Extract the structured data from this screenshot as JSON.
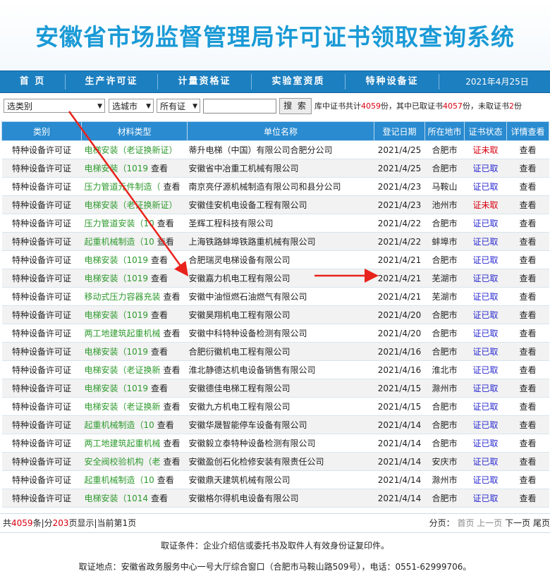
{
  "header": {
    "title": "安徽省市场监督管理局许可证书领取查询系统"
  },
  "nav": {
    "items": [
      "首 页",
      "生产许可证",
      "计量资格证",
      "实验室资质",
      "特种设备证"
    ],
    "date": "2021年4月25日"
  },
  "toolbar": {
    "category_select": "选类别",
    "city_select": "选城市",
    "cert_select": "所有证",
    "search_value": "",
    "search_button": "搜 索",
    "summary_prefix": "库中证书共计",
    "total": "4059",
    "summary_mid1": "份，其中已取证书",
    "taken": "4057",
    "summary_mid2": "份，未取证书",
    "not_taken": "2",
    "summary_end": "份"
  },
  "table": {
    "headers": [
      "类别",
      "材料类型",
      "单位名称",
      "登记日期",
      "所在地市",
      "证书状态",
      "详情查看"
    ],
    "rows": [
      {
        "type": "特种设备许可证",
        "material": "电梯安装（老证换新证）",
        "view_text": "",
        "unit": "蒂升电梯（中国）有限公司合肥分公司",
        "date": "2021/4/25",
        "city": "合肥市",
        "status": "证未取",
        "action": "查看"
      },
      {
        "type": "特种设备许可证",
        "material": "电梯安装（1019",
        "view_text": "查看",
        "unit": "安徽省中冶重工机械有限公司",
        "date": "2021/4/25",
        "city": "合肥市",
        "status": "证已取",
        "action": "查看"
      },
      {
        "type": "特种设备许可证",
        "material": "压力管道元件制造（",
        "view_text": "查看",
        "unit": "南京亮仔源机械制造有限公司和县分公司",
        "date": "2021/4/23",
        "city": "马鞍山",
        "status": "证已取",
        "action": "查看"
      },
      {
        "type": "特种设备许可证",
        "material": "电梯安装（老证换新证）",
        "view_text": "",
        "unit": "安徽佳安机电设备工程有限公司",
        "date": "2021/4/23",
        "city": "池州市",
        "status": "证未取",
        "action": "查看"
      },
      {
        "type": "特种设备许可证",
        "material": "压力管道安装（10",
        "view_text": "查看",
        "unit": "圣辉工程科技有限公司",
        "date": "2021/4/22",
        "city": "合肥市",
        "status": "证已取",
        "action": "查看"
      },
      {
        "type": "特种设备许可证",
        "material": "起重机械制造（10",
        "view_text": "查看",
        "unit": "上海铁路蚌埠铁路重机械有限公司",
        "date": "2021/4/22",
        "city": "蚌埠市",
        "status": "证已取",
        "action": "查看"
      },
      {
        "type": "特种设备许可证",
        "material": "电梯安装（1019",
        "view_text": "查看",
        "unit": "合肥瑞灵电梯设备有限公司",
        "date": "2021/4/21",
        "city": "合肥市",
        "status": "证已取",
        "action": "查看"
      },
      {
        "type": "特种设备许可证",
        "material": "电梯安装（1019",
        "view_text": "查看",
        "unit": "安徽嘉力机电工程有限公司",
        "date": "2021/4/21",
        "city": "芜湖市",
        "status": "证已取",
        "action": "查看"
      },
      {
        "type": "特种设备许可证",
        "material": "移动式压力容器充装",
        "view_text": "查看",
        "unit": "安徽中油恒燃石油燃气有限公司",
        "date": "2021/4/21",
        "city": "芜湖市",
        "status": "证已取",
        "action": "查看"
      },
      {
        "type": "特种设备许可证",
        "material": "电梯安装（1019",
        "view_text": "查看",
        "unit": "安徽昊翔机电工程有限公司",
        "date": "2021/4/20",
        "city": "合肥市",
        "status": "证已取",
        "action": "查看"
      },
      {
        "type": "特种设备许可证",
        "material": "两工地建筑起重机械",
        "view_text": "查看",
        "unit": "安徽中科特种设备检测有限公司",
        "date": "2021/4/20",
        "city": "合肥市",
        "status": "证已取",
        "action": "查看"
      },
      {
        "type": "特种设备许可证",
        "material": "电梯安装（1019",
        "view_text": "查看",
        "unit": "合肥衍徽机电工程有限公司",
        "date": "2021/4/16",
        "city": "合肥市",
        "status": "证已取",
        "action": "查看"
      },
      {
        "type": "特种设备许可证",
        "material": "电梯安装（老证换新",
        "view_text": "查看",
        "unit": "淮北静德达机电设备销售有限公司",
        "date": "2021/4/16",
        "city": "淮北市",
        "status": "证已取",
        "action": "查看"
      },
      {
        "type": "特种设备许可证",
        "material": "电梯安装（1019",
        "view_text": "查看",
        "unit": "安徽德佳电梯工程有限公司",
        "date": "2021/4/15",
        "city": "滁州市",
        "status": "证已取",
        "action": "查看"
      },
      {
        "type": "特种设备许可证",
        "material": "电梯安装（老证换新",
        "view_text": "查看",
        "unit": "安徽九方机电工程有限公司",
        "date": "2021/4/15",
        "city": "合肥市",
        "status": "证已取",
        "action": "查看"
      },
      {
        "type": "特种设备许可证",
        "material": "起重机械制造（10",
        "view_text": "查看",
        "unit": "安徽华晟智能停车设备有限公司",
        "date": "2021/4/14",
        "city": "合肥市",
        "status": "证已取",
        "action": "查看"
      },
      {
        "type": "特种设备许可证",
        "material": "两工地建筑起重机械",
        "view_text": "查看",
        "unit": "安徽毅立泰特种设备检测有限公司",
        "date": "2021/4/14",
        "city": "合肥市",
        "status": "证已取",
        "action": "查看"
      },
      {
        "type": "特种设备许可证",
        "material": "安全阀校验机构（老",
        "view_text": "查看",
        "unit": "安徽盈创石化检修安装有限责任公司",
        "date": "2021/4/14",
        "city": "安庆市",
        "status": "证已取",
        "action": "查看"
      },
      {
        "type": "特种设备许可证",
        "material": "起重机械制造（10",
        "view_text": "查看",
        "unit": "安徽鼎天建筑机械有限公司",
        "date": "2021/4/14",
        "city": "滁州市",
        "status": "证已取",
        "action": "查看"
      },
      {
        "type": "特种设备许可证",
        "material": "电梯安装（1014",
        "view_text": "查看",
        "unit": "安徽格尔得机电设备有限公司",
        "date": "2021/4/14",
        "city": "合肥市",
        "status": "证已取",
        "action": "查看"
      }
    ]
  },
  "footer": {
    "count_prefix": "共",
    "count": "4059",
    "count_mid": "条|分",
    "pages": "203",
    "count_end": "页显示|当前第1页",
    "pager_label": "分页：",
    "first": "首页",
    "prev": "上一页",
    "next": "下一页",
    "last": "尾页",
    "note1": "取证条件：企业介绍信或委托书及取件人有效身份证复印件。",
    "note2": "取证地点：安徽省政务服务中心一号大厅综合窗口（合肥市马鞍山路509号），电话：0551-62999706。"
  },
  "colors": {
    "accent": "#1c7fc0",
    "title": "#1a9ad6",
    "arrow": "#e8231c",
    "status_not_taken": "#d8000f",
    "status_taken": "#2a2ad0",
    "material": "#2f9a2f"
  }
}
